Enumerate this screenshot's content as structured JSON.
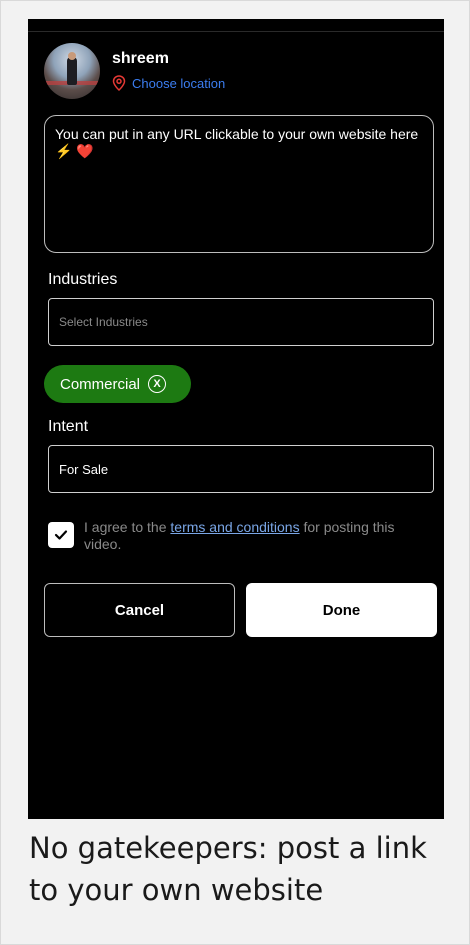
{
  "user": {
    "name": "shreem",
    "location_label": "Choose location"
  },
  "description": {
    "text": "You can put in any URL clickable to your own website here ⚡ ❤️"
  },
  "industries": {
    "label": "Industries",
    "placeholder": "Select Industries",
    "selected": [
      {
        "label": "Commercial",
        "remove": "X"
      }
    ]
  },
  "intent": {
    "label": "Intent",
    "value": "For Sale"
  },
  "agreement": {
    "checked": true,
    "prefix": "I agree to the ",
    "link": "terms and conditions",
    "suffix": " for posting this video."
  },
  "actions": {
    "cancel": "Cancel",
    "done": "Done"
  },
  "caption": "No gatekeepers: post a link to your own website",
  "colors": {
    "chip": "#1d7a12",
    "link": "#3b7df0",
    "pin": "#e53935"
  }
}
